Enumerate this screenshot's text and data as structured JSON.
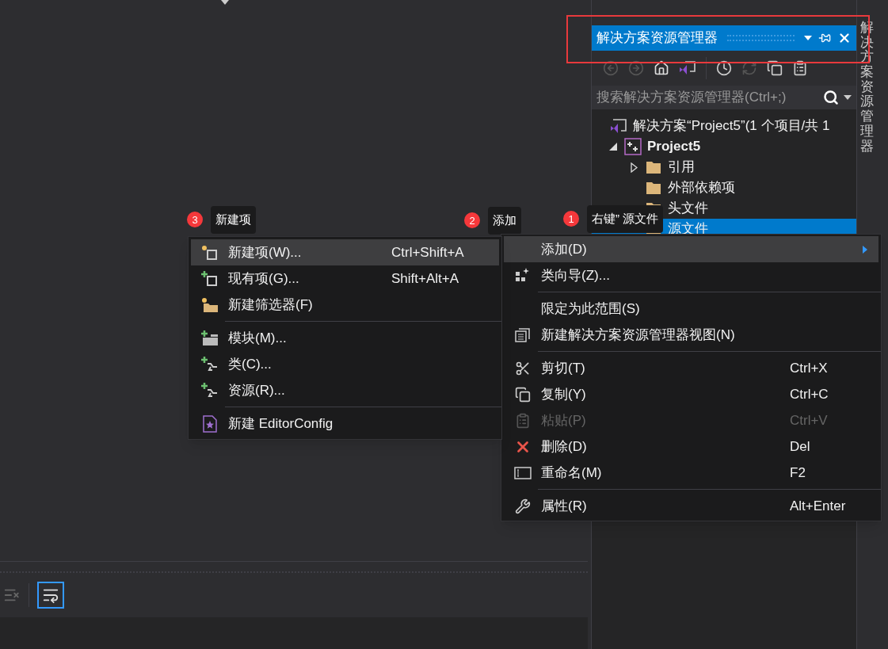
{
  "explorer": {
    "title": "解决方案资源管理器",
    "search": {
      "placeholder": "搜索解决方案资源管理器(Ctrl+;)"
    },
    "tree": [
      {
        "label": "解决方案“Project5”(1 个项目/共 1",
        "bold": false,
        "selected": false,
        "children": [
          {
            "label": "Project5",
            "bold": true,
            "selected": false,
            "expanded": true,
            "children": [
              {
                "label": "引用",
                "bold": false,
                "selected": false,
                "expanded": false
              },
              {
                "label": "外部依赖项",
                "bold": false,
                "selected": false
              },
              {
                "label": "头文件",
                "bold": false,
                "selected": false
              },
              {
                "label": "源文件",
                "bold": false,
                "selected": true
              }
            ]
          }
        ]
      }
    ]
  },
  "side_tab": {
    "label": "解决方案资源管理器"
  },
  "context_menu": {
    "items": [
      {
        "kind": "item",
        "label": "添加(D)",
        "selected": true,
        "disabled": false,
        "submenu": true
      },
      {
        "kind": "item",
        "label": "类向导(Z)...",
        "selected": false,
        "disabled": false,
        "submenu": false
      },
      {
        "kind": "separator"
      },
      {
        "kind": "item",
        "label": "限定为此范围(S)",
        "selected": false,
        "disabled": false,
        "submenu": false
      },
      {
        "kind": "item",
        "label": "新建解决方案资源管理器视图(N)",
        "selected": false,
        "disabled": false,
        "submenu": false
      },
      {
        "kind": "separator"
      },
      {
        "kind": "item",
        "label": "剪切(T)",
        "shortcut": "Ctrl+X",
        "selected": false,
        "disabled": false,
        "submenu": false
      },
      {
        "kind": "item",
        "label": "复制(Y)",
        "shortcut": "Ctrl+C",
        "selected": false,
        "disabled": false,
        "submenu": false
      },
      {
        "kind": "item",
        "label": "粘贴(P)",
        "shortcut": "Ctrl+V",
        "selected": false,
        "disabled": true,
        "submenu": false
      },
      {
        "kind": "item",
        "label": "删除(D)",
        "shortcut": "Del",
        "selected": false,
        "disabled": false,
        "submenu": false
      },
      {
        "kind": "item",
        "label": "重命名(M)",
        "shortcut": "F2",
        "selected": false,
        "disabled": false,
        "submenu": false
      },
      {
        "kind": "separator"
      },
      {
        "kind": "item",
        "label": "属性(R)",
        "shortcut": "Alt+Enter",
        "selected": false,
        "disabled": false,
        "submenu": false
      }
    ]
  },
  "submenu": {
    "items": [
      {
        "kind": "item",
        "label": "新建项(W)...",
        "shortcut": "Ctrl+Shift+A",
        "selected": true
      },
      {
        "kind": "item",
        "label": "现有项(G)...",
        "shortcut": "Shift+Alt+A",
        "selected": false
      },
      {
        "kind": "item",
        "label": "新建筛选器(F)",
        "selected": false
      },
      {
        "kind": "separator"
      },
      {
        "kind": "item",
        "label": "模块(M)...",
        "selected": false
      },
      {
        "kind": "item",
        "label": "类(C)...",
        "selected": false
      },
      {
        "kind": "item",
        "label": "资源(R)...",
        "selected": false
      },
      {
        "kind": "separator"
      },
      {
        "kind": "item",
        "label": "新建 EditorConfig",
        "selected": false
      }
    ]
  },
  "callouts": [
    {
      "number": "3",
      "text": "新建项"
    },
    {
      "number": "2",
      "text": "添加"
    },
    {
      "number": "1",
      "text": "右键” 源文件"
    }
  ]
}
